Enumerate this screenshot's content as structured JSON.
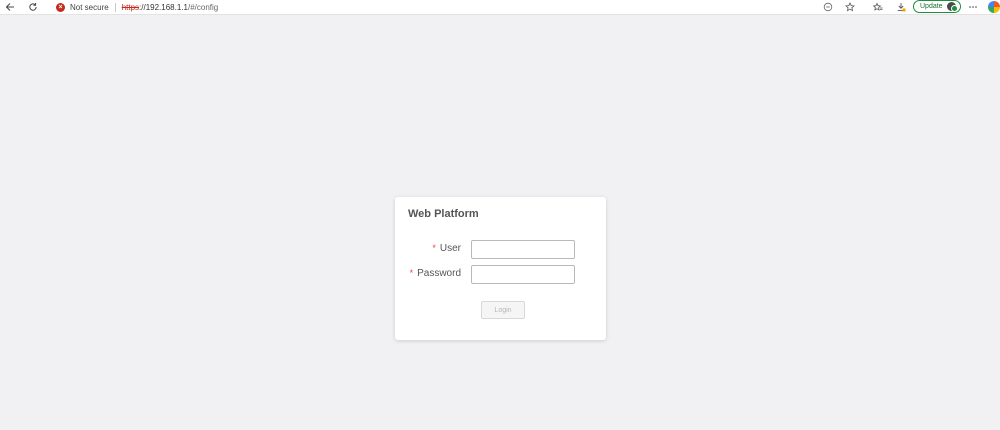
{
  "browser": {
    "security_text": "Not secure",
    "url_scheme": "https",
    "url_host": "://192.168.1.1",
    "url_path": "/#/config",
    "update_label": "Update",
    "icons": [
      "back-arrow-icon",
      "reload-icon",
      "reader-icon",
      "star-icon",
      "favorites-icon",
      "download-icon",
      "more-icon",
      "copilot-icon"
    ]
  },
  "login": {
    "title": "Web Platform",
    "user_label": "User",
    "user_value": "",
    "password_label": "Password",
    "password_value": "",
    "required_mark": "*",
    "button_label": "Login"
  },
  "colors": {
    "background": "#f1f1f4",
    "required": "#ee4444",
    "not_secure": "#c42b1c",
    "update_green": "#1e8e3e"
  }
}
